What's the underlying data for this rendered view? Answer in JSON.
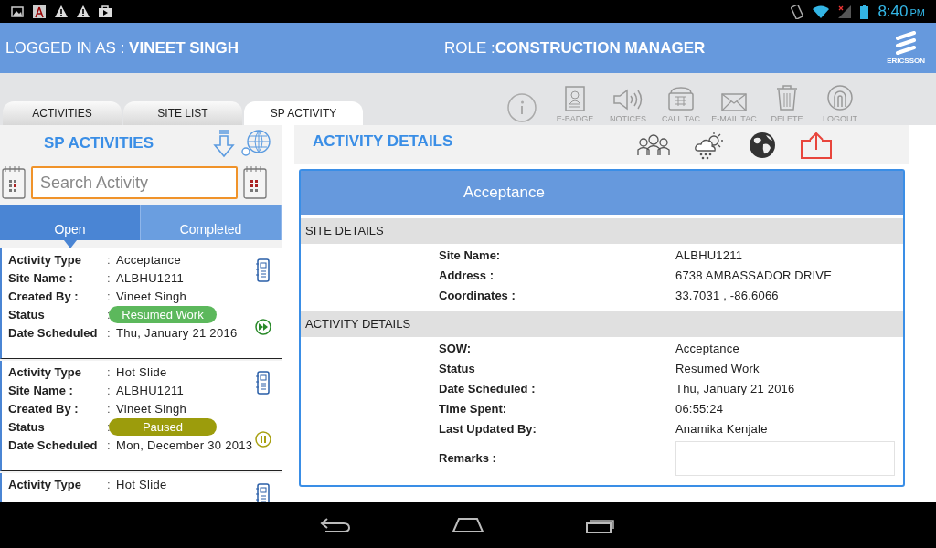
{
  "status_bar": {
    "time": "8:40",
    "ampm": "PM"
  },
  "header": {
    "logged_label": "LOGGED IN AS :",
    "user": "VINEET SINGH",
    "role_label": "ROLE :",
    "role": "CONSTRUCTION MANAGER",
    "logo": "ERICSSON"
  },
  "tabs": [
    {
      "label": "ACTIVITIES",
      "selected": false
    },
    {
      "label": "SITE LIST",
      "selected": false
    },
    {
      "label": "SP ACTIVITY",
      "selected": true
    }
  ],
  "toolbar": [
    {
      "kind": "info"
    },
    {
      "kind": "badge",
      "label": "E-BADGE"
    },
    {
      "kind": "notices",
      "label": "NOTICES"
    },
    {
      "kind": "phone",
      "label": "CALL TAC"
    },
    {
      "kind": "mail",
      "label": "E-MAIL TAC"
    },
    {
      "kind": "delete",
      "label": "DELETE"
    },
    {
      "kind": "logout",
      "label": "LOGOUT"
    }
  ],
  "left": {
    "title": "SP ACTIVITIES",
    "search": {
      "placeholder": "Search Activity"
    },
    "segments": [
      {
        "label": "Open",
        "selected": true
      },
      {
        "label": "Completed",
        "selected": false
      }
    ],
    "activities": [
      {
        "kind": "play",
        "rows": [
          {
            "label": "Activity Type",
            "sep": ":",
            "value": "Acceptance"
          },
          {
            "label": "Site Name :",
            "sep": ":",
            "value": "ALBHU1211"
          },
          {
            "label": "Created By :",
            "sep": ":",
            "value": "Vineet Singh"
          },
          {
            "label": "Status",
            "sep": ":",
            "value": "Resumed Work",
            "kind": "pill",
            "color": "#5cb85c"
          },
          {
            "label": "Date Scheduled",
            "sep": ":",
            "value": "Thu, January 21 2016"
          }
        ]
      },
      {
        "kind": "pause",
        "rows": [
          {
            "label": "Activity Type",
            "sep": ":",
            "value": "Hot Slide"
          },
          {
            "label": "Site Name :",
            "sep": ":",
            "value": "ALBHU1211"
          },
          {
            "label": "Created By :",
            "sep": ":",
            "value": "Vineet Singh"
          },
          {
            "label": "Status",
            "sep": ":",
            "value": "Paused",
            "kind": "pill",
            "color": "#9c9c0c"
          },
          {
            "label": "Date Scheduled",
            "sep": ":",
            "value": "Mon, December 30 2013"
          }
        ]
      },
      {
        "rows": [
          {
            "label": "Activity Type",
            "sep": ":",
            "value": "Hot Slide"
          }
        ]
      }
    ]
  },
  "details": {
    "title": "ACTIVITY DETAILS",
    "actions": [
      {
        "kind": "people"
      },
      {
        "kind": "weather"
      },
      {
        "kind": "globe"
      },
      {
        "kind": "share"
      }
    ],
    "heading": "Acceptance",
    "sections": [
      {
        "title": "SITE DETAILS",
        "rows": [
          {
            "label": "Site Name:",
            "value": "ALBHU1211"
          },
          {
            "label": "Address :",
            "value": "6738 AMBASSADOR DRIVE"
          },
          {
            "label": "Coordinates :",
            "value": "33.7031 , -86.6066"
          }
        ]
      },
      {
        "title": "ACTIVITY DETAILS",
        "rows": [
          {
            "label": "SOW:",
            "value": "Acceptance"
          },
          {
            "label": "Status",
            "value": "Resumed Work"
          },
          {
            "label": "Date Scheduled :",
            "value": "Thu, January 21 2016"
          },
          {
            "label": "Time Spent:",
            "value": "06:55:24"
          },
          {
            "label": "Last Updated By:",
            "value": "Anamika Kenjale"
          }
        ]
      }
    ],
    "remarks": {
      "label": "Remarks :"
    }
  }
}
